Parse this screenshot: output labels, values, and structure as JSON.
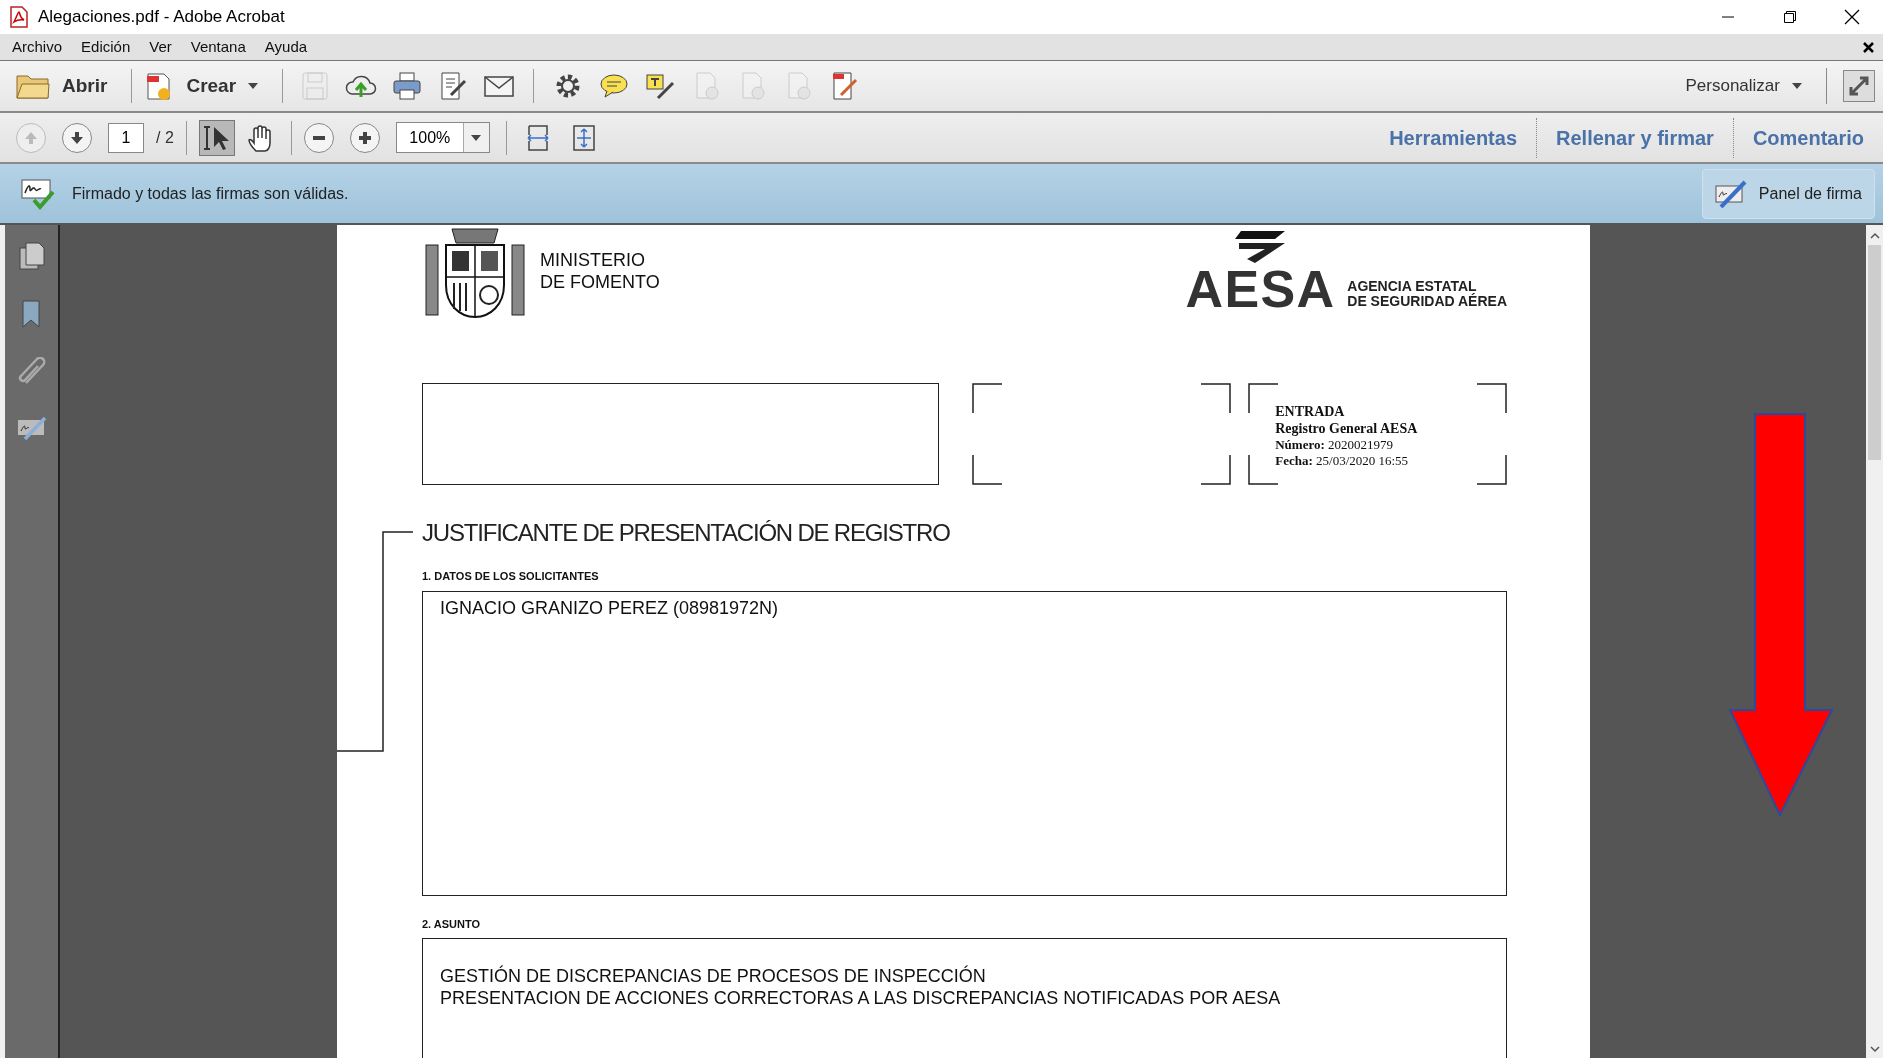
{
  "window": {
    "title": "Alegaciones.pdf - Adobe Acrobat"
  },
  "menu": [
    "Archivo",
    "Edición",
    "Ver",
    "Ventana",
    "Ayuda"
  ],
  "toolbar": {
    "open_label": "Abrir",
    "create_label": "Crear",
    "customize_label": "Personalizar",
    "icons": [
      {
        "kind": "save",
        "disabled": true
      },
      {
        "kind": "upload",
        "disabled": false
      },
      {
        "kind": "print",
        "disabled": false
      },
      {
        "kind": "edit",
        "disabled": false
      },
      {
        "kind": "mail",
        "disabled": false
      },
      {
        "kind": "gear",
        "disabled": false
      },
      {
        "kind": "comment",
        "disabled": false
      },
      {
        "kind": "highlight",
        "disabled": false
      },
      {
        "kind": "doc",
        "disabled": true
      },
      {
        "kind": "doc",
        "disabled": true
      },
      {
        "kind": "doc",
        "disabled": true
      },
      {
        "kind": "sign",
        "disabled": false
      }
    ]
  },
  "navbar": {
    "page": "1",
    "total": "/ 2",
    "zoom": "100%",
    "tools": [
      {
        "kind": "select",
        "selected": true
      },
      {
        "kind": "hand",
        "selected": false
      }
    ],
    "tabs": [
      "Herramientas",
      "Rellenar y firmar",
      "Comentario"
    ]
  },
  "signature_bar": {
    "message": "Firmado y todas las firmas son válidas.",
    "button": "Panel de firma"
  },
  "document": {
    "ministry": [
      "MINISTERIO",
      "DE FOMENTO"
    ],
    "agency_logo": "AESA",
    "agency": [
      "AGENCIA ESTATAL",
      "DE SEGURIDAD AÉREA"
    ],
    "stamp": [
      "ENTRADA",
      "Registro General AESA",
      "**Número:** 2020021979",
      "**Fecha:** 25/03/2020 16:55"
    ],
    "title": "JUSTIFICANTE DE PRESENTACIÓN DE REGISTRO",
    "sections": [
      {
        "heading": "1. DATOS DE LOS SOLICITANTES",
        "lines": [
          "IGNACIO GRANIZO PEREZ (08981972N)"
        ]
      },
      {
        "heading": "2. ASUNTO",
        "lines": [
          "GESTIÓN DE DISCREPANCIAS DE PROCESOS DE INSPECCIÓN",
          "PRESENTACION DE ACCIONES CORRECTORAS A LAS DISCREPANCIAS NOTIFICADAS POR AESA"
        ]
      }
    ]
  }
}
